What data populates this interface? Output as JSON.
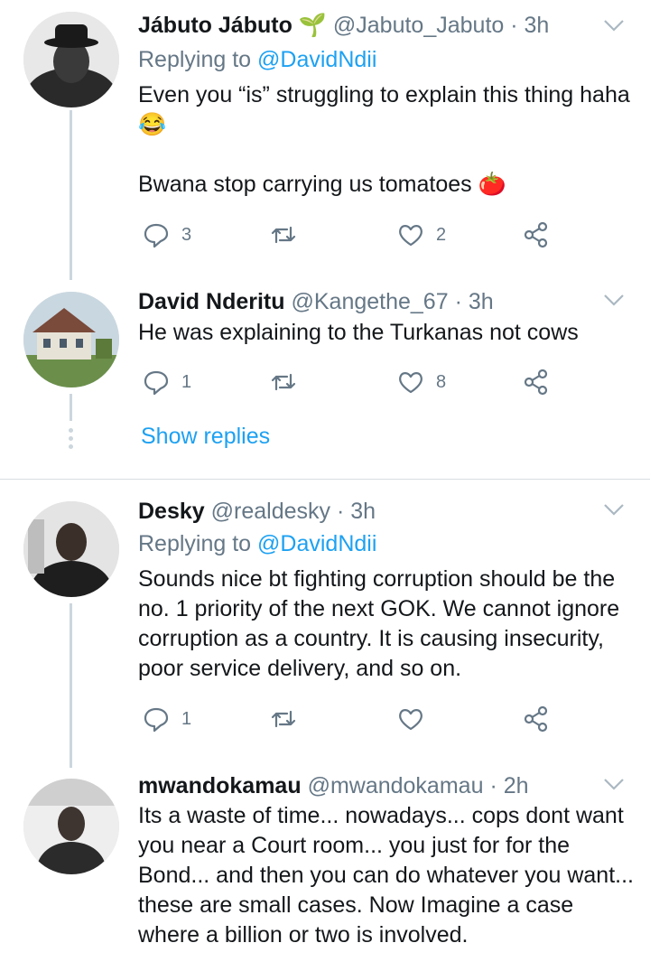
{
  "tweets": [
    {
      "name": "Jábuto Jábuto",
      "name_emoji": "🌱",
      "handle": "@Jabuto_Jabuto",
      "time": "· 3h",
      "replying_prefix": "Replying to",
      "replying_to": "@DavidNdii",
      "text_line1": "Even you “is” struggling to explain this thing haha",
      "text_emoji1": "😂",
      "text_line2": "Bwana stop carrying us tomatoes",
      "text_emoji2": "🍅",
      "reply_count": "3",
      "like_count": "2"
    },
    {
      "name": "David Nderitu",
      "handle": "@Kangethe_67",
      "time": "· 3h",
      "text": "He was explaining to the Turkanas not cows",
      "reply_count": "1",
      "like_count": "8"
    },
    {
      "name": "Desky",
      "handle": "@realdesky",
      "time": "· 3h",
      "replying_prefix": "Replying to",
      "replying_to": "@DavidNdii",
      "text": "Sounds nice bt fighting corruption should be the no. 1 priority of the next GOK. We cannot ignore corruption as a country. It is causing insecurity, poor service delivery, and so on.",
      "reply_count": "1",
      "like_count": ""
    },
    {
      "name": "mwandokamau",
      "handle": "@mwandokamau",
      "time": "· 2h",
      "text": "Its a waste of time... nowadays... cops dont want you near a Court room... you just for for the Bond... and then you can do whatever you want... these are small cases. Now Imagine a case where a billion or two is involved."
    }
  ],
  "show_replies": "Show replies",
  "icons": {
    "reply": "reply-icon",
    "retweet": "retweet-icon",
    "like": "heart-icon",
    "share": "share-icon",
    "menu": "chevron-down-icon"
  },
  "colors": {
    "link": "#1da1f2",
    "muted": "#657786",
    "text": "#14171a",
    "thread_line": "#ccd6dd"
  }
}
